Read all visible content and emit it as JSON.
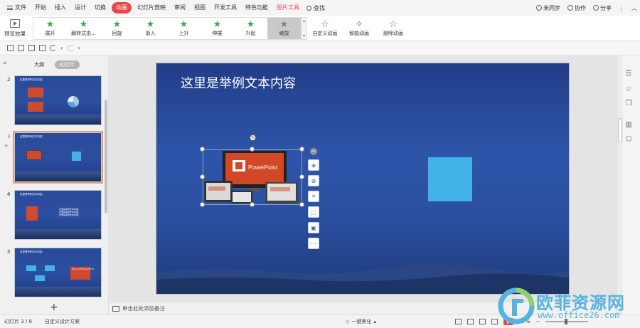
{
  "menubar": {
    "items": [
      "文件",
      "开始",
      "插入",
      "设计",
      "切换",
      "动画",
      "幻灯片放映",
      "审阅",
      "视图",
      "开发工具",
      "特色功能",
      "图片工具"
    ],
    "active_index": 5,
    "search_label": "查找",
    "right": {
      "sync": "未同步",
      "collab": "协作",
      "share": "分享"
    }
  },
  "ribbon": {
    "preview_label": "预览效果",
    "animations": [
      "展开",
      "翻转式由...",
      "回旋",
      "渐入",
      "上升",
      "伸展",
      "升起",
      "缩放"
    ],
    "selected_animation": "缩放",
    "custom_anim": "自定义动画",
    "smart_anim": "智能动画",
    "delete_anim": "删除动画"
  },
  "panel": {
    "tab_outline": "大纲",
    "tab_slides": "幻灯片",
    "slides": [
      {
        "num": "2",
        "title": "这里是举例文本内容"
      },
      {
        "num": "3",
        "title": "这里是举例文本内容"
      },
      {
        "num": "4",
        "title": "这里是举例文本内容",
        "body": "这里是举例文本内容。\n这里是举例文本内容。\n这里是举例文本内容。"
      },
      {
        "num": "5",
        "title": "这里是举例文本内容",
        "badge": "Microsoft PowerPoint"
      }
    ],
    "add_label": "+"
  },
  "slide": {
    "title": "这里是举例文本内容",
    "image_label": "PowerPoint",
    "rect_color": "#42b2e8"
  },
  "notes": {
    "placeholder": "单击此处添加备注"
  },
  "statusbar": {
    "slide_info": "幻灯片 3 / 8",
    "theme": "自定义设计方案",
    "beautify": "一键美化",
    "zoom": "77%"
  },
  "watermark": {
    "text_cn": "欧菲资源网",
    "url": "www.office26.com"
  },
  "colors": {
    "accent": "#e8474c",
    "slide_bg": "#2d4fa0",
    "anim_green": "#3da84a"
  }
}
